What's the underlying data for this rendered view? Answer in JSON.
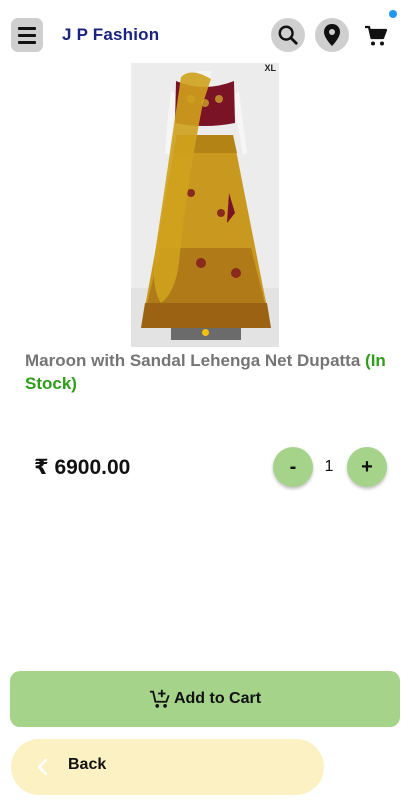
{
  "header": {
    "brand": "J P Fashion",
    "icons": [
      "menu-icon",
      "search-icon",
      "location-pin-icon",
      "cart-icon"
    ],
    "cart_badge_color": "#2196f3"
  },
  "product": {
    "size_tag": "XL",
    "name": "Maroon with Sandal Lehenga Net Dupatta",
    "stock_status": "(In Stock)",
    "price": "₹ 6900.00",
    "quantity": "1",
    "carousel_slide_count": 1,
    "carousel_active_index": 0
  },
  "stepper": {
    "minus_label": "-",
    "plus_label": "+"
  },
  "actions": {
    "add_to_cart_label": "Add to Cart",
    "back_label": "Back"
  },
  "colors": {
    "brand": "#1a237e",
    "in_stock": "#2e9d1a",
    "primary_button": "#a5d38a",
    "back_button": "#fcf1c2",
    "carousel_dot": "#f4c20d"
  }
}
